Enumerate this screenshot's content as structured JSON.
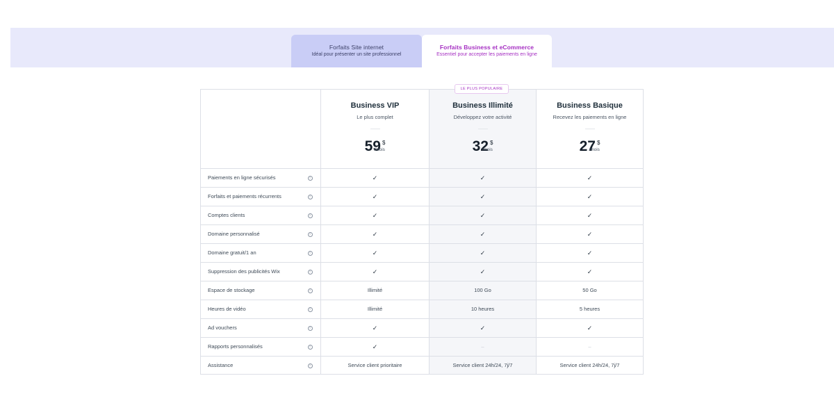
{
  "tabs": [
    {
      "title": "Forfaits Site internet",
      "subtitle": "Idéal pour présenter un site professionnel",
      "active": false
    },
    {
      "title": "Forfaits Business et eCommerce",
      "subtitle": "Essentiel pour accepter les paiements en ligne",
      "active": true
    }
  ],
  "badge": "LE PLUS POPULAIRE",
  "plans": [
    {
      "name": "Business VIP",
      "desc": "Le plus complet",
      "price": "59",
      "currency": "$",
      "period": "/mois"
    },
    {
      "name": "Business Illimité",
      "desc": "Développez votre activité",
      "price": "32",
      "currency": "$",
      "period": "/mois"
    },
    {
      "name": "Business Basique",
      "desc": "Recevez les paiements en ligne",
      "price": "27",
      "currency": "$",
      "period": "/mois"
    }
  ],
  "info_glyph": "i",
  "features": [
    {
      "label": "Paiements en ligne sécurisés",
      "v1": "✓",
      "v2": "✓",
      "v3": "✓"
    },
    {
      "label": "Forfaits et paiements récurrents",
      "v1": "✓",
      "v2": "✓",
      "v3": "✓"
    },
    {
      "label": "Comptes clients",
      "v1": "✓",
      "v2": "✓",
      "v3": "✓"
    },
    {
      "label": "Domaine personnalisé",
      "v1": "✓",
      "v2": "✓",
      "v3": "✓"
    },
    {
      "label": "Domaine gratuit/1 an",
      "v1": "✓",
      "v2": "✓",
      "v3": "✓"
    },
    {
      "label": "Suppression des publicités Wix",
      "v1": "✓",
      "v2": "✓",
      "v3": "✓"
    },
    {
      "label": "Espace de stockage",
      "v1": "Illimité",
      "v2": "100 Go",
      "v3": "50 Go"
    },
    {
      "label": "Heures de vidéo",
      "v1": "Illimité",
      "v2": "10 heures",
      "v3": "5 heures"
    },
    {
      "label": "Ad vouchers",
      "v1": "✓",
      "v2": "✓",
      "v3": "✓"
    },
    {
      "label": "Rapports personnalisés",
      "v1": "✓",
      "v2": "–",
      "v3": "–"
    },
    {
      "label": "Assistance",
      "v1": "Service client prioritaire",
      "v2": "Service client 24h/24, 7j/7",
      "v3": "Service client 24h/24, 7j/7"
    }
  ],
  "colors": {
    "accent": "#a52fc2",
    "tabbar": "#e8e9fb",
    "tab_inactive": "#c9cdf6",
    "popular_bg": "#f5f6f9"
  }
}
